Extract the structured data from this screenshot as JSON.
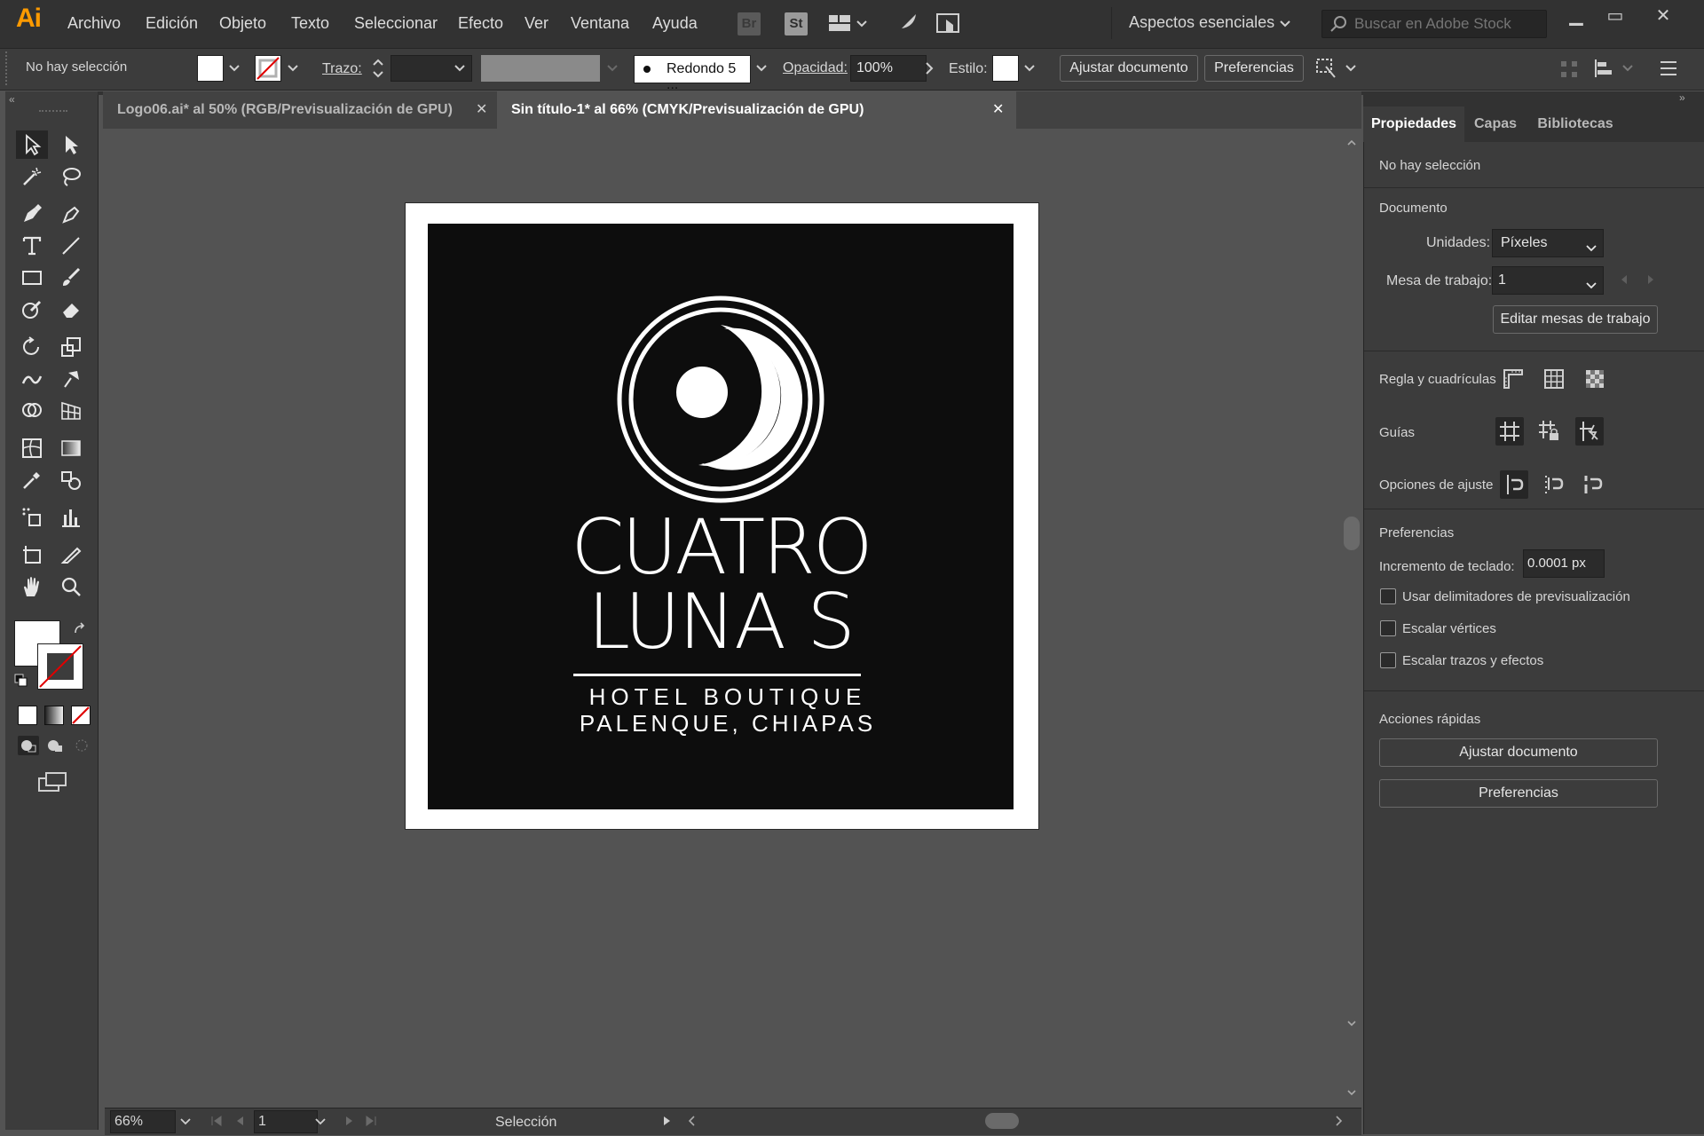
{
  "app": {
    "logo": "Ai",
    "accent": "#ff9a00"
  },
  "menu": {
    "items": [
      "Archivo",
      "Edición",
      "Objeto",
      "Texto",
      "Seleccionar",
      "Efecto",
      "Ver",
      "Ventana",
      "Ayuda"
    ],
    "bridge_icon": "Br",
    "stock_icon": "St",
    "workspace": "Aspectos esenciales",
    "stock_search_placeholder": "Buscar en Adobe Stock"
  },
  "control_bar": {
    "selection_status": "No hay selección",
    "stroke_label": "Trazo:",
    "brush_label": "Redondo 5 ...",
    "opacity_label": "Opacidad:",
    "opacity_value": "100%",
    "style_label": "Estilo:",
    "adjust_doc_button": "Ajustar documento",
    "preferences_button": "Preferencias"
  },
  "tabs": [
    {
      "label": "Logo06.ai* al 50% (RGB/Previsualización de GPU)",
      "active": false
    },
    {
      "label": "Sin título-1* al 66% (CMYK/Previsualización de GPU)",
      "active": true
    }
  ],
  "artwork": {
    "line1": "CUATRO",
    "line2": "LUNA S",
    "line3": "HOTEL BOUTIQUE",
    "line4": "PALENQUE, CHIAPAS"
  },
  "status_bar": {
    "zoom": "66%",
    "artboard_number": "1",
    "tool_name": "Selección"
  },
  "panel": {
    "tabs": [
      "Propiedades",
      "Capas",
      "Bibliotecas"
    ],
    "selection_status": "No hay selección",
    "document_section": "Documento",
    "units_label": "Unidades:",
    "units_value": "Píxeles",
    "artboard_label": "Mesa de trabajo:",
    "artboard_value": "1",
    "edit_artboards_button": "Editar mesas de trabajo",
    "rulers_label": "Regla y cuadrículas",
    "guides_label": "Guías",
    "snap_label": "Opciones de ajuste",
    "preferences_section": "Preferencias",
    "keyboard_increment_label": "Incremento de teclado:",
    "keyboard_increment_value": "0.0001 px",
    "checkboxes": [
      "Usar delimitadores de previsualización",
      "Escalar vértices",
      "Escalar trazos y efectos"
    ],
    "quick_actions_section": "Acciones rápidas",
    "quick_adjust_button": "Ajustar documento",
    "quick_preferences_button": "Preferencias"
  }
}
